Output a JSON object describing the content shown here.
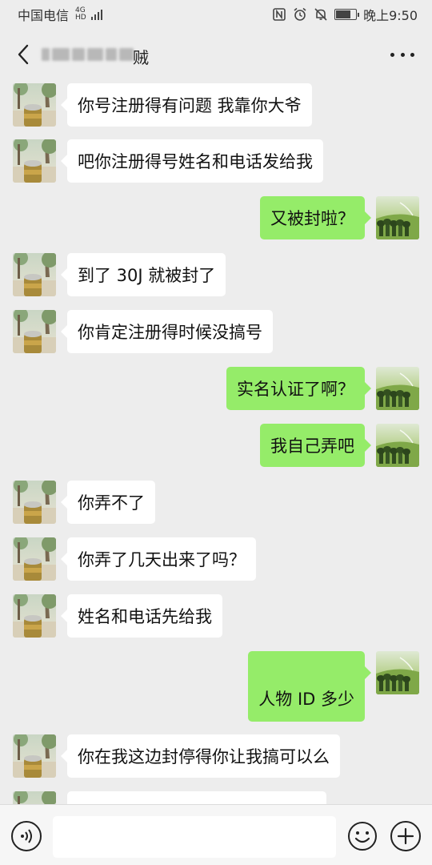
{
  "status_bar": {
    "carrier": "中国电信",
    "network_type": "4G",
    "network_sub": "HD",
    "time": "晚上9:50",
    "icons": [
      "nfc-icon",
      "alarm-icon",
      "mute-icon",
      "battery-icon"
    ]
  },
  "header": {
    "back_icon": "chevron-left-icon",
    "title_visible_end": "贼",
    "more_icon": "more-dots-icon"
  },
  "messages": [
    {
      "side": "left",
      "text": "你号注册得有问题 我靠你大爷"
    },
    {
      "side": "left",
      "text": "吧你注册得号姓名和电话发给我"
    },
    {
      "side": "right",
      "text": "又被封啦？"
    },
    {
      "side": "left",
      "text": "到了 30J 就被封了"
    },
    {
      "side": "left",
      "text": "你肯定注册得时候没搞号"
    },
    {
      "side": "right",
      "text": "实名认证了啊？"
    },
    {
      "side": "right",
      "text": "我自己弄吧"
    },
    {
      "side": "left",
      "text": "你弄不了"
    },
    {
      "side": "left",
      "text": "你弄了几天出来了吗？"
    },
    {
      "side": "left",
      "text": "姓名和电话先给我"
    },
    {
      "side": "right",
      "text": "人物 ID 多少"
    },
    {
      "side": "left",
      "text": "你在我这边封停得你让我搞可以么"
    },
    {
      "side": "left",
      "text": ""
    }
  ],
  "input_bar": {
    "voice_icon": "voice-icon",
    "input_value": "",
    "emoji_icon": "emoji-icon",
    "plus_icon": "plus-icon"
  },
  "colors": {
    "background": "#ededed",
    "bubble_self": "#95ec69",
    "bubble_other": "#ffffff"
  }
}
